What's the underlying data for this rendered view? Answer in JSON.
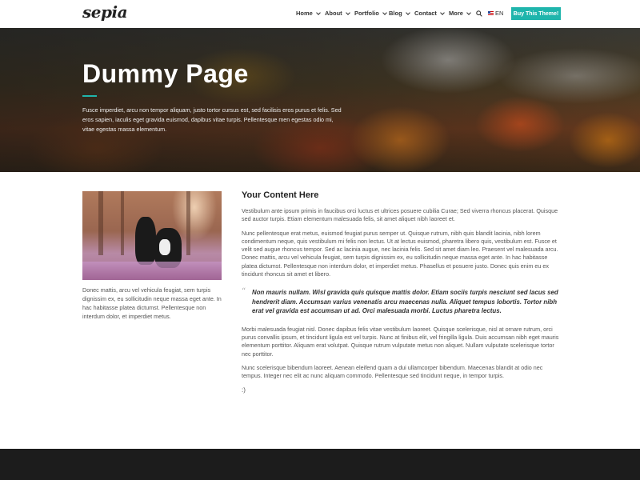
{
  "header": {
    "logo": "sepia",
    "nav": [
      {
        "label": "Home",
        "has_dropdown": true
      },
      {
        "label": "About",
        "has_dropdown": true
      },
      {
        "label": "Portfolio",
        "has_dropdown": true
      },
      {
        "label": "Blog",
        "has_dropdown": true
      },
      {
        "label": "Contact",
        "has_dropdown": true
      },
      {
        "label": "More",
        "has_dropdown": true
      }
    ],
    "search_icon": "search-icon",
    "language": "EN",
    "buy_button": "Buy This Theme!",
    "accent_color": "#1fb5ac"
  },
  "hero": {
    "title": "Dummy Page",
    "text": "Fusce imperdiet, arcu non tempor aliquam, justo tortor cursus est, sed facilisis eros purus et felis. Sed eros sapien, iaculis eget gravida euismod, dapibus vitae turpis. Pellentesque men egestas odio mi, vitae egestas massa elementum."
  },
  "sidebar": {
    "caption": "Donec mattis, arcu vel vehicula feugiat, sem turpis dignissim ex, eu sollicitudin neque massa eget ante. In hac habitasse platea dictumst. Pellentesque non interdum dolor, et imperdiet metus."
  },
  "content": {
    "title": "Your Content Here",
    "paragraphs": [
      "Vestibulum ante ipsum primis in faucibus orci luctus et ultrices posuere cubilia Curae; Sed viverra rhoncus placerat. Quisque sed auctor turpis. Etiam elementum malesuada felis, sit amet aliquet nibh laoreet et.",
      "Nunc pellentesque erat metus, euismod feugiat purus semper ut. Quisque rutrum, nibh quis blandit lacinia, nibh lorem condimentum neque, quis vestibulum mi felis non lectus. Ut at lectus euismod, pharetra libero quis, vestibulum est. Fusce et velit sed augue rhoncus tempor. Sed ac lacinia augue, nec lacinia felis. Sed sit amet diam leo. Praesent vel malesuada arcu. Donec mattis, arcu vel vehicula feugiat, sem turpis dignissim ex, eu sollicitudin neque massa eget ante. In hac habitasse platea dictumst. Pellentesque non interdum dolor, et imperdiet metus. Phasellus et posuere justo. Donec quis enim eu ex tincidunt rhoncus sit amet et libero."
    ],
    "quote_mark": "“",
    "quote": "Non mauris nullam. Wisl gravida quis quisque mattis dolor. Etiam sociis turpis nesciunt sed lacus sed hendrerit diam. Accumsan varius venenatis arcu maecenas nulla. Aliquet tempus lobortis. Tortor nibh erat vel gravida est accumsan ut ad. Orci malesuada morbi. Luctus pharetra lectus.",
    "paragraphs_after": [
      "Morbi malesuada feugiat nisl. Donec dapibus felis vitae vestibulum laoreet. Quisque scelerisque, nisl at ornare rutrum, orci purus convallis ipsum, et tincidunt ligula est vel turpis. Nunc at finibus elit, vel fringilla ligula. Duis accumsan nibh eget mauris elementum porttitor. Aliquam erat volutpat. Quisque rutrum vulputate metus non aliquet. Nullam vulputate scelerisque tortor nec porttitor.",
      "Nunc scelerisque bibendum laoreet. Aenean eleifend quam a dui ullamcorper bibendum. Maecenas blandit at odio nec tempus. Integer nec elit ac nunc aliquam commodo. Pellentesque sed tincidunt neque, in tempor turpis."
    ],
    "closing": ":)"
  }
}
